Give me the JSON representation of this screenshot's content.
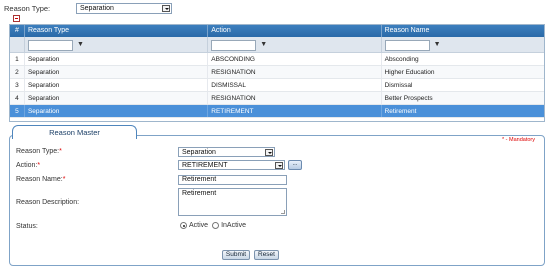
{
  "filter": {
    "label": "Reason Type:",
    "value": "Separation"
  },
  "grid": {
    "headers": [
      "#",
      "Reason Type",
      "Action",
      "Reason Name"
    ],
    "filter_icon": "filter-icon",
    "rows": [
      {
        "num": "1",
        "reason_type": "Separation",
        "action": "ABSCONDING",
        "reason_name": "Absconding"
      },
      {
        "num": "2",
        "reason_type": "Separation",
        "action": "RESIGNATION",
        "reason_name": "Higher Education"
      },
      {
        "num": "3",
        "reason_type": "Separation",
        "action": "DISMISSAL",
        "reason_name": "Dismissal"
      },
      {
        "num": "4",
        "reason_type": "Separation",
        "action": "RESIGNATION",
        "reason_name": "Better Prospects"
      },
      {
        "num": "5",
        "reason_type": "Separation",
        "action": "RETIREMENT",
        "reason_name": "Retirement"
      }
    ],
    "selected_row": 5
  },
  "master": {
    "title": "Reason Master",
    "mandatory_note": "* - Mandatory",
    "reason_type_label": "Reason Type:",
    "reason_type_value": "Separation",
    "action_label": "Action:",
    "action_value": "RETIREMENT",
    "lookup_label": "...",
    "reason_name_label": "Reason Name:",
    "reason_name_value": "Retirement",
    "reason_description_label": "Reason Description:",
    "reason_description_value": "Retirement",
    "status_label": "Status:",
    "status_options": [
      "Active",
      "InActive"
    ],
    "status_selected": "Active",
    "submit_label": "Submit",
    "reset_label": "Reset",
    "required_marker": "*"
  },
  "colors": {
    "header_blue": "#2f72b2",
    "selected_row": "#4a90d9",
    "required_red": "#dd0000",
    "border_blue": "#7fa3c7"
  }
}
